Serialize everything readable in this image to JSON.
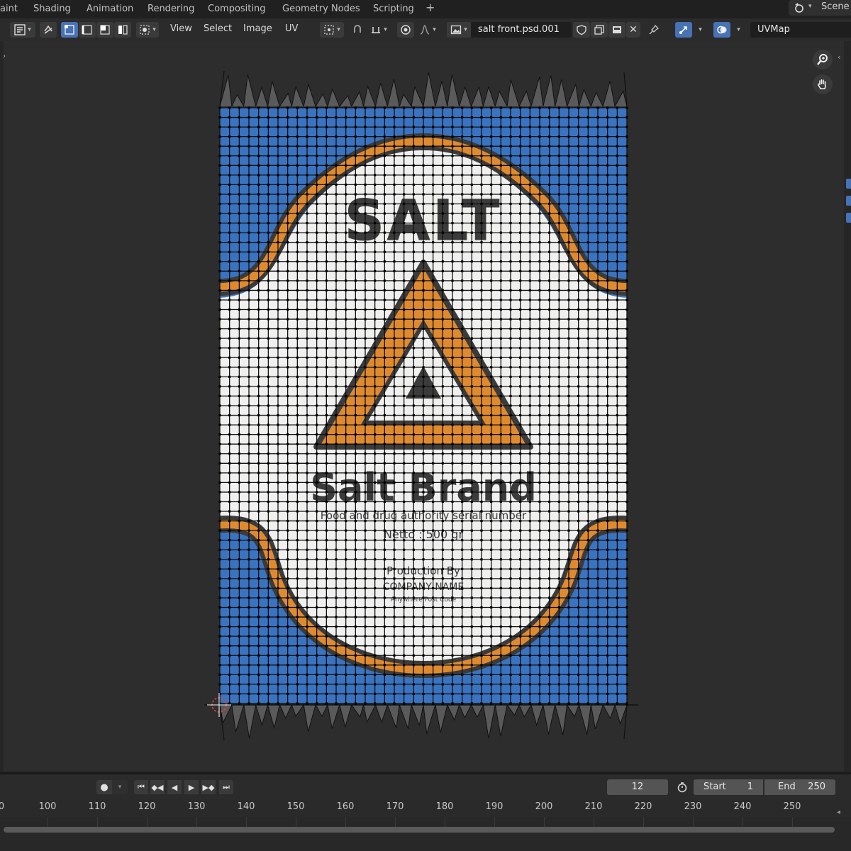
{
  "workspaces": [
    "aint",
    "Shading",
    "Animation",
    "Rendering",
    "Compositing",
    "Geometry Nodes",
    "Scripting",
    "+"
  ],
  "scene": {
    "label": "Scene"
  },
  "header": {
    "menus": [
      "View",
      "Select",
      "Image",
      "UV"
    ],
    "image_name": "salt front.psd.001",
    "uv_map": "UVMap"
  },
  "label_art": {
    "title": "SALT",
    "brand": "Salt Brand",
    "serial": "Food and drug authority serial number",
    "netto": "Netto : 500 gr",
    "production": "Production By",
    "company": "COMPANY NAME",
    "small": "Anywhere Post Code",
    "colors": {
      "blue": "#3a73c0",
      "orange": "#e08a2f",
      "dark": "#3b3b3b",
      "paper": "#f0f0ef"
    }
  },
  "timeline": {
    "current_frame": "12",
    "start_label": "Start",
    "start_value": "1",
    "end_label": "End",
    "end_value": "250",
    "ruler_ticks": [
      "0",
      "100",
      "110",
      "120",
      "130",
      "140",
      "150",
      "160",
      "170",
      "180",
      "190",
      "200",
      "210",
      "220",
      "230",
      "240",
      "250"
    ]
  },
  "icons": [
    "uv-editor-icon",
    "sync-icon",
    "vertex-select-icon",
    "edge-select-icon",
    "face-select-icon",
    "island-select-icon",
    "sticky-select-icon",
    "pivot-icon",
    "snap-icon",
    "proportional-icon",
    "image-browse-icon",
    "fake-user-icon",
    "new-image-icon",
    "open-image-icon",
    "unlink-icon",
    "pin-icon",
    "gizmo-icon",
    "overlay-icon",
    "zoom-icon",
    "hand-icon",
    "record-icon",
    "jump-start-icon",
    "keyframe-prev-icon",
    "play-reverse-icon",
    "play-icon",
    "keyframe-next-icon",
    "jump-end-icon",
    "stopwatch-icon"
  ]
}
